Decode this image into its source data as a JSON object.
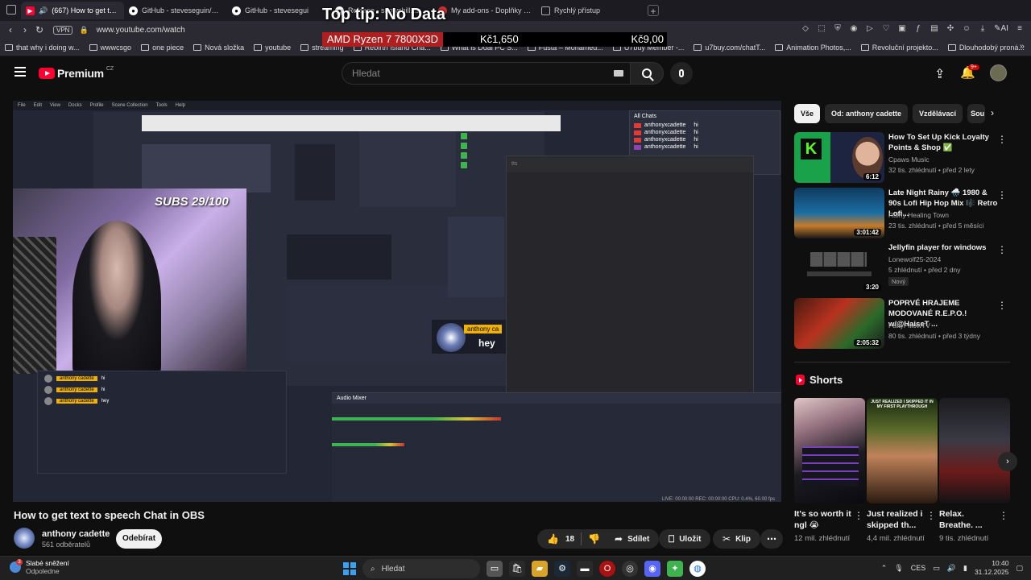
{
  "browser": {
    "tabs": [
      {
        "label": "(667) How to get text t",
        "icon": "youtube-icon",
        "active": true
      },
      {
        "label": "GitHub - steveseguin/soci",
        "icon": "github-icon"
      },
      {
        "label": "GitHub - stevesegui",
        "icon": "github-icon"
      },
      {
        "label": "Release - snowshill.css-se",
        "icon": "github-icon"
      },
      {
        "label": "My add-ons - Doplňky Op",
        "icon": "opera-icon"
      },
      {
        "label": "Rychlý přístup",
        "icon": "speed-dial-icon"
      }
    ],
    "vpn_label": "VPN",
    "url": "www.youtube.com/watch",
    "bookmarks": [
      "that why i doing w...",
      "wwwcsgo",
      "one piece",
      "Nová složka",
      "youtube",
      "streaming",
      "Rebirth Island Cha...",
      "What is Dual PC S...",
      "Fusta – Mohamed...",
      "U7buy Member -...",
      "u7buy.com/chatT...",
      "Animation Photos,...",
      "Revoluční projekto...",
      "Dlouhodobý proná..."
    ]
  },
  "overlay": {
    "title": "Top tip: No Data",
    "product": "AMD Ryzen 7 7800X3D",
    "price1": "Kč1,650",
    "price2": "Kč9,00"
  },
  "yt": {
    "logo_text": "Premium",
    "region": "CZ",
    "search_placeholder": "Hledat",
    "notif_count": "9+"
  },
  "video": {
    "title": "How to get text to speech Chat in OBS",
    "channel": "anthony cadette",
    "subscribers": "561 odběratelů",
    "subscribe_label": "Odebírat",
    "likes": "18",
    "share_label": "Sdílet",
    "save_label": "Uložit",
    "clip_label": "Klip",
    "overlay_subs": "SUBS 29/100",
    "overlay_chat_name": "anthony ca",
    "overlay_chat_msg": "hey",
    "tts_title": "tts",
    "all_chats": "All Chats",
    "audio_mixer": "Audio Mixer",
    "chat_user": "anthonyxcadette",
    "chat_msg": "hi",
    "obs_menu": [
      "File",
      "Edit",
      "View",
      "Docks",
      "Profile",
      "Scene Collection",
      "Tools",
      "Help"
    ],
    "obs_status": "LIVE: 00:00:00  REC: 00:00:00  CPU: 0.4%, 60.00 fps"
  },
  "sidebar": {
    "chips": [
      "Vše",
      "Od: anthony cadette",
      "Vzdělávací",
      "Sou"
    ],
    "recs": [
      {
        "title": "How To Set Up Kick Loyalty Points & Shop ✅",
        "channel": "Cpaws Music",
        "meta": "32 tis. zhlédnutí • před 2 lety",
        "duration": "6:12"
      },
      {
        "title": "Late Night Rainy 🌧️ 1980 & 90s Lofi Hip Hop Mix 🎼 Retro Lofi...",
        "channel": "Rainy Healing Town",
        "meta": "23 tis. zhlédnutí • před 5 měsíci",
        "duration": "3:01:42"
      },
      {
        "title": "Jellyfin player for windows",
        "channel": "Lonewolf25-2024",
        "meta": "5 zhlédnutí • před 2 dny",
        "duration": "3:20",
        "badge": "Nový"
      },
      {
        "title": "POPRVÉ HRAJEME MODOVANÉ R.E.P.O.! w/@HaiseT ...",
        "channel": "FattyPillowTV",
        "meta": "80 tis. zhlédnutí • před 3 týdny",
        "duration": "2:05:32"
      }
    ],
    "shorts_label": "Shorts",
    "shorts": [
      {
        "title": "It's so worth it ngl 😭",
        "views": "12 mil. zhlédnutí"
      },
      {
        "title": "Just realized i skipped th...",
        "views": "4,4 mil. zhlédnutí"
      },
      {
        "title": "Relax. Breathe. ...",
        "views": "9 tis. zhlédnutí"
      }
    ]
  },
  "taskbar": {
    "weather_line1": "Slabé sněžení",
    "weather_line2": "Odpoledne",
    "weather_badge": "3",
    "search_label": "Hledat",
    "language": "CES",
    "time": "10:40",
    "date": "31.12.2025"
  },
  "colors": {
    "yt_red": "#ff0033",
    "background": "#0f0f0f",
    "chip_bg": "#272727",
    "browser_bg": "#2b2a33"
  }
}
